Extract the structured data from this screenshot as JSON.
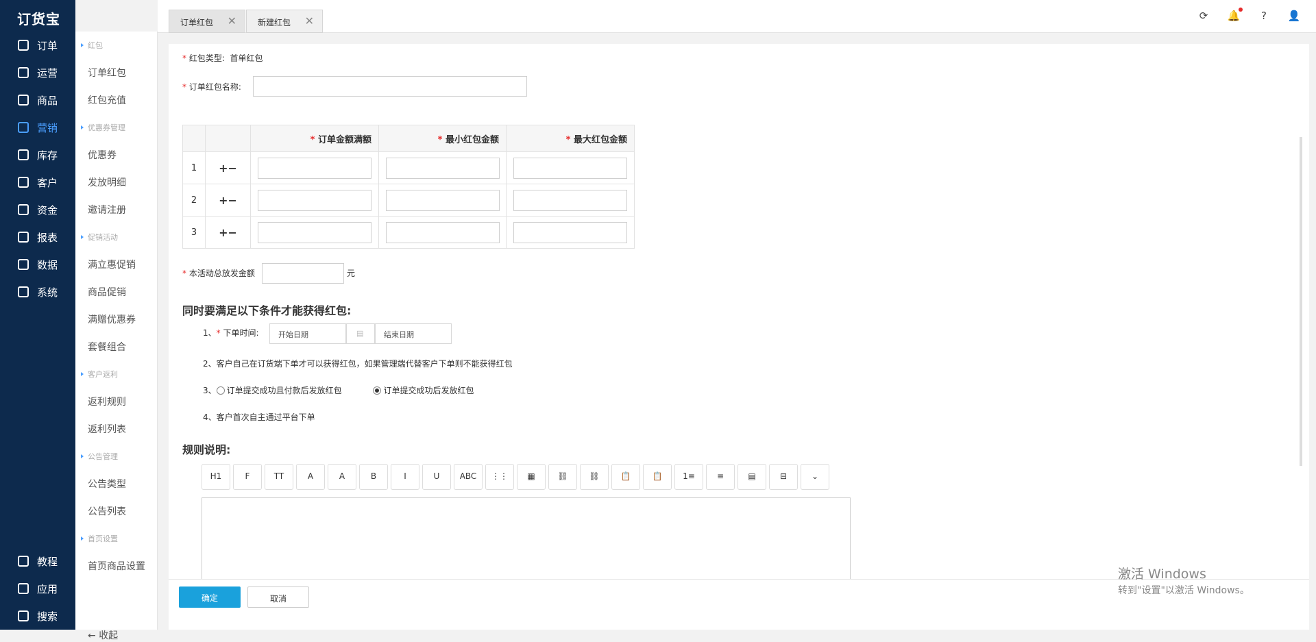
{
  "logo": "订货宝",
  "nav": [
    {
      "label": "订单",
      "icon": "order-icon"
    },
    {
      "label": "运营",
      "icon": "operation-icon"
    },
    {
      "label": "商品",
      "icon": "goods-icon"
    },
    {
      "label": "营销",
      "icon": "marketing-icon",
      "active": true
    },
    {
      "label": "库存",
      "icon": "warehouse-icon"
    },
    {
      "label": "客户",
      "icon": "user-icon"
    },
    {
      "label": "资金",
      "icon": "money-icon"
    },
    {
      "label": "报表",
      "icon": "pie-icon"
    },
    {
      "label": "数据",
      "icon": "data-icon"
    },
    {
      "label": "系统",
      "icon": "monitor-icon"
    }
  ],
  "nav_bottom": [
    {
      "label": "教程",
      "icon": "video-icon"
    },
    {
      "label": "应用",
      "icon": "cube-icon"
    },
    {
      "label": "搜索",
      "icon": "search-icon"
    }
  ],
  "sub": {
    "groups": [
      {
        "title": "红包",
        "items": [
          "订单红包",
          "红包充值"
        ]
      },
      {
        "title": "优惠券管理",
        "items": [
          "优惠券",
          "发放明细",
          "邀请注册"
        ]
      },
      {
        "title": "促销活动",
        "items": [
          "满立惠促销",
          "商品促销",
          "满赠优惠券",
          "套餐组合"
        ]
      },
      {
        "title": "客户返利",
        "items": [
          "返利规则",
          "返利列表"
        ]
      },
      {
        "title": "公告管理",
        "items": [
          "公告类型",
          "公告列表"
        ]
      },
      {
        "title": "首页设置",
        "items": [
          "首页商品设置"
        ]
      }
    ],
    "collapse": "收起"
  },
  "tabs": [
    {
      "label": "订单红包"
    },
    {
      "label": "新建红包",
      "active": true
    }
  ],
  "form": {
    "type_label": "红包类型:",
    "type_value": "首单红包",
    "name_label": "订单红包名称:",
    "col1": "订单金额满额",
    "col2": "最小红包金额",
    "col3": "最大红包金额",
    "rows": [
      "1",
      "2",
      "3"
    ],
    "total_label": "本活动总放发金额",
    "total_unit": "元",
    "cond_title": "同时要满足以下条件才能获得红包:",
    "c1_prefix": "1、",
    "c1_label": "下单时间:",
    "start_date": "开始日期",
    "end_date": "结束日期",
    "c2": "2、客户自己在订货端下单才可以获得红包，如果管理端代替客户下单则不能获得红包",
    "c3_prefix": "3、",
    "c3_opt1": "订单提交成功且付款后发放红包",
    "c3_opt2": "订单提交成功后发放红包",
    "c4": "4、客户首次自主通过平台下单",
    "rules_title": "规则说明:"
  },
  "toolbar": [
    "H1",
    "F",
    "TT",
    "A",
    "A",
    "B",
    "I",
    "U",
    "ABC",
    "⋮⋮",
    "▦",
    "⛓",
    "⛓",
    "📋",
    "📋",
    "1≡",
    "≡",
    "▤",
    "⊟",
    "⌄"
  ],
  "buttons": {
    "ok": "确定",
    "cancel": "取消"
  },
  "watermark": {
    "line1": "激活 Windows",
    "line2": "转到\"设置\"以激活 Windows。"
  }
}
